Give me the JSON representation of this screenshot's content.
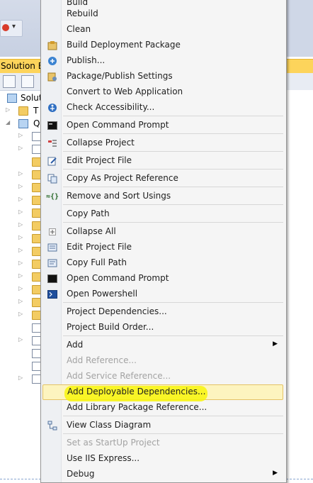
{
  "solution_explorer": {
    "title": "Solution Ex",
    "tree": [
      {
        "label": "Soluti"
      },
      {
        "label": "T"
      },
      {
        "label": "Q"
      }
    ]
  },
  "context_menu": {
    "items": [
      {
        "label": "Build",
        "icon": "build-icon",
        "enabled": true
      },
      {
        "label": "Rebuild",
        "enabled": true
      },
      {
        "label": "Clean",
        "enabled": true
      },
      {
        "label": "Build Deployment Package",
        "icon": "package-icon",
        "enabled": true
      },
      {
        "label": "Publish...",
        "icon": "publish-icon",
        "enabled": true
      },
      {
        "label": "Package/Publish Settings",
        "icon": "settings-icon",
        "enabled": true
      },
      {
        "label": "Convert to Web Application",
        "enabled": true
      },
      {
        "label": "Check Accessibility...",
        "icon": "accessibility-icon",
        "enabled": true
      },
      {
        "label": "Open Command Prompt",
        "icon": "console-icon",
        "enabled": true
      },
      {
        "label": "Collapse Project",
        "icon": "collapse-project-icon",
        "enabled": true
      },
      {
        "label": "Edit Project File",
        "icon": "edit-file-icon",
        "enabled": true
      },
      {
        "label": "Copy As Project Reference",
        "icon": "copy-reference-icon",
        "enabled": true
      },
      {
        "label": "Remove and Sort Usings",
        "icon": "sort-usings-icon",
        "enabled": true
      },
      {
        "label": "Copy Path",
        "enabled": true
      },
      {
        "label": "Collapse All",
        "icon": "plus-box-icon",
        "enabled": true
      },
      {
        "label": "Edit Project File",
        "icon": "edit-file-icon",
        "enabled": true
      },
      {
        "label": "Copy Full Path",
        "icon": "copy-path-icon",
        "enabled": true
      },
      {
        "label": "Open Command Prompt",
        "icon": "console-icon",
        "enabled": true
      },
      {
        "label": "Open Powershell",
        "icon": "powershell-icon",
        "enabled": true
      },
      {
        "label": "Project Dependencies...",
        "enabled": true
      },
      {
        "label": "Project Build Order...",
        "enabled": true
      },
      {
        "label": "Add",
        "enabled": true,
        "submenu": true
      },
      {
        "label": "Add Reference...",
        "enabled": false
      },
      {
        "label": "Add Service Reference...",
        "enabled": false
      },
      {
        "label": "Add Deployable Dependencies...",
        "enabled": true,
        "highlighted": true
      },
      {
        "label": "Add Library Package Reference...",
        "enabled": true
      },
      {
        "label": "View Class Diagram",
        "icon": "class-diagram-icon",
        "enabled": true
      },
      {
        "label": "Set as StartUp Project",
        "enabled": false
      },
      {
        "label": "Use IIS Express...",
        "enabled": true
      },
      {
        "label": "Debug",
        "enabled": true,
        "submenu": true
      }
    ]
  },
  "colors": {
    "highlight_marker": "#f8f40a",
    "hover_fill": "#fdf4bf",
    "solution_explorer_title": "#fdd45b"
  }
}
